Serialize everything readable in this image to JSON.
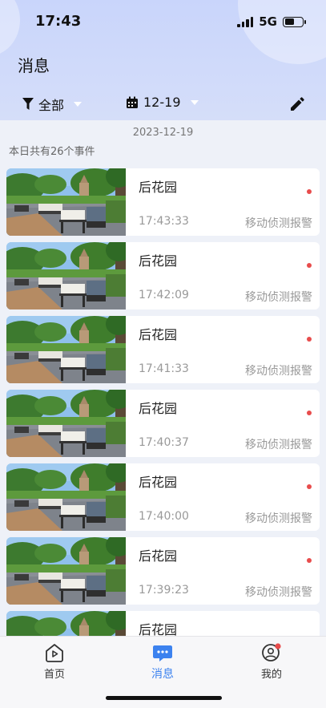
{
  "status": {
    "time": "17:43",
    "network": "5G"
  },
  "page": {
    "title": "消息"
  },
  "filters": {
    "category": "全部",
    "date": "12-19"
  },
  "summary": {
    "date": "2023-12-19",
    "count_text": "本日共有26个事件"
  },
  "events": [
    {
      "title": "后花园",
      "time": "17:43:33",
      "type": "移动侦测报警"
    },
    {
      "title": "后花园",
      "time": "17:42:09",
      "type": "移动侦测报警"
    },
    {
      "title": "后花园",
      "time": "17:41:33",
      "type": "移动侦测报警"
    },
    {
      "title": "后花园",
      "time": "17:40:37",
      "type": "移动侦测报警"
    },
    {
      "title": "后花园",
      "time": "17:40:00",
      "type": "移动侦测报警"
    },
    {
      "title": "后花园",
      "time": "17:39:23",
      "type": "移动侦测报警"
    },
    {
      "title": "后花园",
      "time": "",
      "type": ""
    }
  ],
  "tabs": {
    "home": "首页",
    "messages": "消息",
    "me": "我的"
  },
  "colors": {
    "accent": "#3c82ef",
    "unread": "#e84c4c",
    "header": "#cdd8fb"
  }
}
